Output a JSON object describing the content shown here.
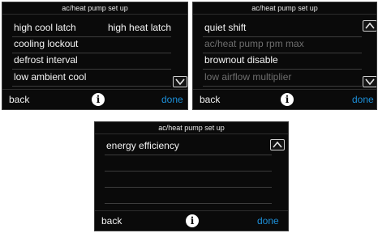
{
  "colors": {
    "background": "#0a0a0a",
    "text": "#f4f4f4",
    "disabled_text": "#6e6e6e",
    "done_accent": "#1c8fd8"
  },
  "screen1": {
    "title": "ac/heat pump set up",
    "items": [
      {
        "label": "high cool latch",
        "enabled": true
      },
      {
        "label": "high heat latch",
        "enabled": true
      },
      {
        "label": "cooling lockout",
        "enabled": true
      },
      {
        "label": "defrost interval",
        "enabled": true
      },
      {
        "label": "low ambient cool",
        "enabled": true
      }
    ],
    "scroll_icon": "chevron-down-icon",
    "back_label": "back",
    "info_icon": "i",
    "done_label": "done"
  },
  "screen2": {
    "title": "ac/heat pump set up",
    "items": [
      {
        "label": "quiet shift",
        "enabled": true
      },
      {
        "label": "ac/heat pump rpm max",
        "enabled": false
      },
      {
        "label": "brownout disable",
        "enabled": true
      },
      {
        "label": "low airflow multiplier",
        "enabled": false
      }
    ],
    "scroll_icons": [
      "chevron-up-icon",
      "chevron-down-icon"
    ],
    "back_label": "back",
    "info_icon": "i",
    "done_label": "done"
  },
  "screen3": {
    "title": "ac/heat pump set up",
    "items": [
      {
        "label": "energy efficiency",
        "enabled": true
      }
    ],
    "scroll_icon": "chevron-up-icon",
    "back_label": "back",
    "info_icon": "i",
    "done_label": "done"
  }
}
